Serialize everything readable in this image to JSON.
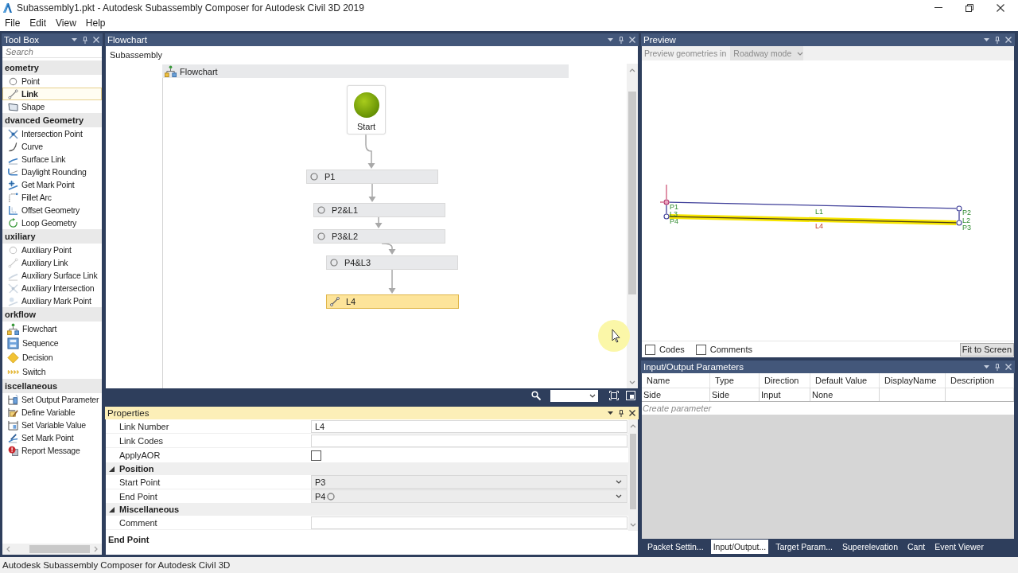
{
  "window": {
    "title": "Subassembly1.pkt - Autodesk Subassembly Composer for Autodesk Civil 3D 2019"
  },
  "menu": [
    "File",
    "Edit",
    "View",
    "Help"
  ],
  "toolbox": {
    "title": "Tool Box",
    "search": {
      "placeholder": "Search"
    },
    "sections": [
      {
        "title": "eometry",
        "items": [
          {
            "label": "Point",
            "selected": false
          },
          {
            "label": "Link",
            "selected": true
          },
          {
            "label": "Shape",
            "selected": false
          }
        ]
      },
      {
        "title": "dvanced Geometry",
        "items": [
          {
            "label": "Intersection Point",
            "selected": false
          },
          {
            "label": "Curve",
            "selected": false
          },
          {
            "label": "Surface Link",
            "selected": false
          },
          {
            "label": "Daylight Rounding",
            "selected": false
          },
          {
            "label": "Get Mark Point",
            "selected": false
          },
          {
            "label": "Fillet Arc",
            "selected": false
          },
          {
            "label": "Offset Geometry",
            "selected": false
          },
          {
            "label": "Loop Geometry",
            "selected": false
          }
        ]
      },
      {
        "title": "uxiliary",
        "items": [
          {
            "label": "Auxiliary Point",
            "selected": false
          },
          {
            "label": "Auxiliary Link",
            "selected": false
          },
          {
            "label": "Auxiliary Surface Link",
            "selected": false
          },
          {
            "label": "Auxiliary Intersection",
            "selected": false
          },
          {
            "label": "Auxiliary Mark Point",
            "selected": false
          }
        ]
      },
      {
        "title": "orkflow",
        "items": [
          {
            "label": "Flowchart",
            "selected": false
          },
          {
            "label": "Sequence",
            "selected": false
          },
          {
            "label": "Decision",
            "selected": false
          },
          {
            "label": "Switch",
            "selected": false
          }
        ]
      },
      {
        "title": "iscellaneous",
        "items": [
          {
            "label": "Set Output Parameter",
            "selected": false
          },
          {
            "label": "Define Variable",
            "selected": false
          },
          {
            "label": "Set Variable Value",
            "selected": false
          },
          {
            "label": "Set Mark Point",
            "selected": false
          },
          {
            "label": "Report Message",
            "selected": false
          }
        ]
      }
    ]
  },
  "flowchart": {
    "title": "Flowchart",
    "breadcrumb": "Subassembly",
    "designer": {
      "title": "Flowchart",
      "nodes": [
        {
          "kind": "start",
          "label": "Start",
          "selected": false
        },
        {
          "kind": "point",
          "label": "P1",
          "selected": false
        },
        {
          "kind": "point",
          "label": "P2&L1",
          "selected": false
        },
        {
          "kind": "point",
          "label": "P3&L2",
          "selected": false
        },
        {
          "kind": "point",
          "label": "P4&L3",
          "selected": false
        },
        {
          "kind": "link",
          "label": "L4",
          "selected": true
        }
      ]
    }
  },
  "properties": {
    "title": "Properties",
    "rows": [
      {
        "kind": "text",
        "label": "Link Number",
        "value": "L4"
      },
      {
        "kind": "text",
        "label": "Link Codes"
      },
      {
        "kind": "checkbox",
        "label": "ApplyAOR",
        "checked": false
      },
      {
        "kind": "category",
        "label": "Position",
        "expanded": true
      },
      {
        "kind": "dropdown",
        "label": "Start Point",
        "value": "P3"
      },
      {
        "kind": "dropdown",
        "label": "End Point",
        "value": "P4"
      },
      {
        "kind": "category",
        "label": "Miscellaneous",
        "expanded": true
      },
      {
        "kind": "text",
        "label": "Comment"
      }
    ],
    "description": "End Point"
  },
  "preview": {
    "title": "Preview",
    "mode": {
      "label": "Preview geometries in",
      "value": "Roadway mode",
      "disabled": true
    },
    "points": [
      {
        "label": "P1"
      },
      {
        "label": "P2"
      },
      {
        "label": "P3"
      },
      {
        "label": "P4"
      }
    ],
    "links": [
      {
        "label": "L3",
        "selected": false
      },
      {
        "label": "L1",
        "selected": false
      },
      {
        "label": "L4",
        "selected": true
      },
      {
        "label": "L2",
        "selected": false
      }
    ],
    "options": [
      {
        "label": "Codes",
        "checked": false
      },
      {
        "label": "Comments",
        "checked": false
      }
    ],
    "fit_button": "Fit to Screen"
  },
  "io_parameters": {
    "title": "Input/Output Parameters",
    "columns": [
      "Name",
      "Type",
      "Direction",
      "Default Value",
      "DisplayName",
      "Description"
    ],
    "rows": [
      {
        "cells": [
          "Side",
          "Side",
          "Input",
          "None"
        ]
      }
    ],
    "new_row": {
      "placeholder": "Create parameter"
    }
  },
  "bottom_tabs": [
    {
      "label": "Packet Settin...",
      "selected": false
    },
    {
      "label": "Input/Output...",
      "selected": true
    },
    {
      "label": "Target Param...",
      "selected": false
    },
    {
      "label": "Superelevation",
      "selected": false
    },
    {
      "label": "Cant",
      "selected": false
    },
    {
      "label": "Event Viewer",
      "selected": false
    }
  ],
  "status_bar": "Autodesk Subassembly Composer for Autodesk Civil 3D"
}
